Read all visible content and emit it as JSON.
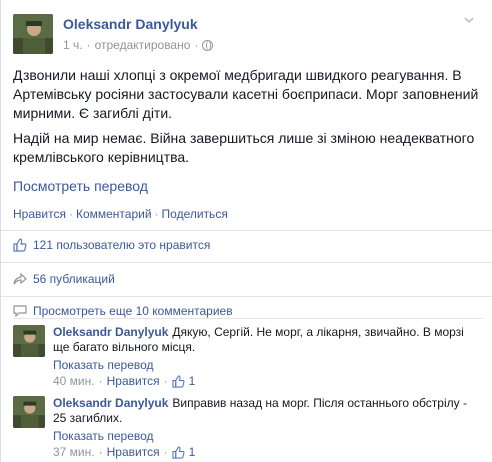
{
  "post": {
    "author": "Oleksandr Danylyuk",
    "time": "1 ч.",
    "edited": "отредактировано",
    "paragraph1": "Дзвонили наші хлопці з окремої медбригади швидкого реагування. В Артемівську росіяни застосували касетні боєприпаси. Морг заповнений мирними. Є загиблі діти.",
    "paragraph2": "Надій на мир немає. Війна завершиться лише зі зміною неадекватного кремлівського керівництва.",
    "translate": "Посмотреть перевод",
    "actions": {
      "like": "Нравится",
      "comment": "Комментарий",
      "share": "Поделиться"
    },
    "dot": "·"
  },
  "stats": {
    "likes": "121 пользователю это нравится",
    "shares": "56 публикаций"
  },
  "more_comments": "Просмотреть еще 10 комментариев",
  "comments": [
    {
      "author": "Oleksandr Danylyuk",
      "text": "Дякую, Сергій. Не морг, а лікарня, звичайно. В морзі ще багато вільного місця.",
      "translate": "Показать перевод",
      "time": "40 мин.",
      "like": "Нравится",
      "likes": "1"
    },
    {
      "author": "Oleksandr Danylyuk",
      "text": "Виправив назад на морг. Після останнього обстрілу - 25 загиблих.",
      "translate": "Показать перевод",
      "time": "37 мин.",
      "like": "Нравится",
      "likes": "1"
    }
  ],
  "colors": {
    "link": "#3b5998",
    "meta": "#90949c",
    "text": "#141823"
  },
  "icons": [
    "globe-icon",
    "chevron-down-icon",
    "thumbs-up-icon",
    "share-icon",
    "comment-icon"
  ]
}
